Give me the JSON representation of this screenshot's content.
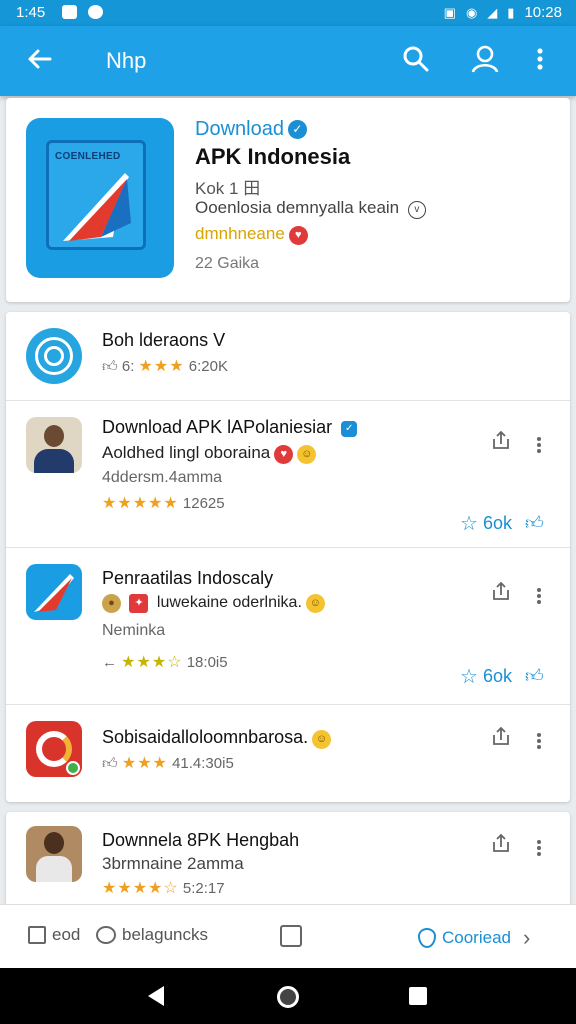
{
  "status_bar": {
    "time_left": "1:45",
    "time_right": "10:28"
  },
  "app_bar": {
    "title": "Nhp"
  },
  "featured": {
    "icon_brand": "COENLEHED",
    "download_label": "Download",
    "app_name": "APK Indonesia",
    "version": "Kok 1 田",
    "description": "Ooenlosia demnyalla keain",
    "tag": "dmnhneane",
    "count": "22 Gaika"
  },
  "list": [
    {
      "title": "Boh lderaons V",
      "rating_text": "6:",
      "stars": "★★★",
      "rating_extra": "6:20K"
    },
    {
      "title": "Download APK lAPolaniesiar",
      "subtitle": "Aoldhed lingl oboraina",
      "meta": "4ddersm.4amma",
      "stars": "★★★★★",
      "rating_extra": "12625",
      "action": "6ok"
    },
    {
      "title": "Penraatilas Indoscaly",
      "subtitle": "luwekaine oderlnika.",
      "meta": "Neminka",
      "stars": "★★★☆",
      "rating_extra": "18:0i5",
      "action": "6ok"
    },
    {
      "title": "Sobisaidalloloomnbarosa.",
      "stars": "★★★",
      "rating_extra": "41.4:30i5"
    },
    {
      "title": "Downnela 8PK Hengbah",
      "subtitle": "3brmnaine 2amma",
      "stars": "★★★★☆",
      "rating_extra": "5:2:17"
    }
  ],
  "bottom_bar": {
    "item1": "eod",
    "item2": "belaguncks",
    "item4": "Cooriead"
  }
}
